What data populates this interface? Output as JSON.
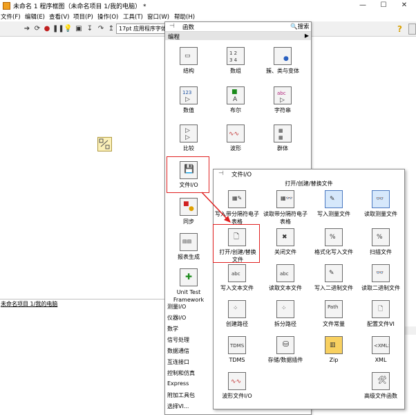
{
  "window": {
    "title": "未命名 1 程序框图（未命名项目 1/我的电脑）",
    "title_suffix": "*",
    "status_path": "未命名项目 1/我的电脑"
  },
  "menubar": {
    "items": [
      "文件(F)",
      "编辑(E)",
      "查看(V)",
      "项目(P)",
      "操作(O)",
      "工具(T)",
      "窗口(W)",
      "帮助(H)"
    ]
  },
  "toolbar": {
    "font_value": "17pt 应用程序字体",
    "icons": [
      "arrow-icon",
      "run-icon",
      "abort-icon",
      "pause-icon",
      "highlight-icon",
      "retain-icon",
      "step-into-icon",
      "step-over-icon",
      "step-out-icon"
    ]
  },
  "functions_palette": {
    "title": "函数",
    "search_label": "搜索",
    "category": "编程",
    "items": [
      {
        "label": "结构",
        "icon": "structures-icon"
      },
      {
        "label": "数组",
        "icon": "array-icon"
      },
      {
        "label": "簇、类与变体",
        "icon": "cluster-icon"
      },
      {
        "label": "数值",
        "icon": "numeric-icon"
      },
      {
        "label": "布尔",
        "icon": "boolean-icon"
      },
      {
        "label": "字符串",
        "icon": "string-icon"
      },
      {
        "label": "比较",
        "icon": "comparison-icon"
      },
      {
        "label": "波形",
        "icon": "waveform-icon"
      },
      {
        "label": "群体",
        "icon": "collections-icon"
      },
      {
        "label": "文件I/O",
        "icon": "file-io-icon"
      },
      {
        "label": "同步",
        "icon": "synchronization-icon"
      },
      {
        "label": "报表生成",
        "icon": "report-icon"
      },
      {
        "label": "Unit Test Framework",
        "icon": "unit-test-icon"
      }
    ],
    "list": [
      "测量I/O",
      "仪器I/O",
      "数学",
      "信号处理",
      "数据通信",
      "互连接口",
      "控制和仿真",
      "Express",
      "附加工具包",
      "选择VI..."
    ]
  },
  "fileio_palette": {
    "title": "文件I/O",
    "subtitle": "打开/创建/替换文件",
    "items": [
      {
        "label": "写入带分隔符电子表格",
        "icon": "write-delimited-icon"
      },
      {
        "label": "读取带分隔符电子表格",
        "icon": "read-delimited-icon"
      },
      {
        "label": "写入测量文件",
        "icon": "write-measurement-icon"
      },
      {
        "label": "读取测量文件",
        "icon": "read-measurement-icon"
      },
      {
        "label": "打开/创建/替换文件",
        "icon": "open-file-icon"
      },
      {
        "label": "关闭文件",
        "icon": "close-file-icon"
      },
      {
        "label": "格式化写入文件",
        "icon": "format-into-file-icon"
      },
      {
        "label": "扫描文件",
        "icon": "scan-file-icon"
      },
      {
        "label": "写入文本文件",
        "icon": "write-text-icon"
      },
      {
        "label": "读取文本文件",
        "icon": "read-text-icon"
      },
      {
        "label": "写入二进制文件",
        "icon": "write-binary-icon"
      },
      {
        "label": "读取二进制文件",
        "icon": "read-binary-icon"
      },
      {
        "label": "创建路径",
        "icon": "build-path-icon"
      },
      {
        "label": "拆分路径",
        "icon": "strip-path-icon"
      },
      {
        "label": "文件常量",
        "icon": "file-constants-icon"
      },
      {
        "label": "配置文件VI",
        "icon": "config-file-icon"
      },
      {
        "label": "TDMS",
        "icon": "tdms-icon"
      },
      {
        "label": "存储/数据插件",
        "icon": "storage-icon"
      },
      {
        "label": "Zip",
        "icon": "zip-icon"
      },
      {
        "label": "XML",
        "icon": "xml-icon"
      },
      {
        "label": "波形文件I/O",
        "icon": "waveform-file-icon"
      },
      {
        "label": "高级文件函数",
        "icon": "advanced-file-icon"
      }
    ]
  },
  "colors": {
    "highlight": "#e02020",
    "selected_bg": "#d6e8fb"
  }
}
